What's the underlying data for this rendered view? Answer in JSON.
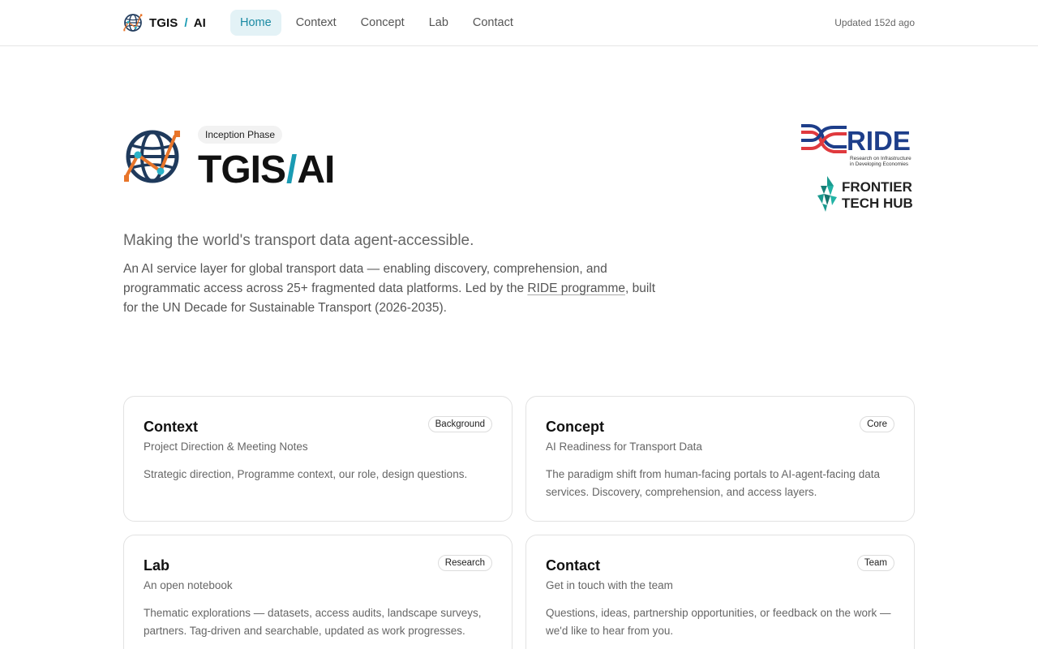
{
  "header": {
    "brand_left": "TGIS",
    "brand_sep": "/",
    "brand_right": "AI",
    "updated": "Updated 152d ago",
    "nav": [
      {
        "label": "Home",
        "active": true
      },
      {
        "label": "Context",
        "active": false
      },
      {
        "label": "Concept",
        "active": false
      },
      {
        "label": "Lab",
        "active": false
      },
      {
        "label": "Contact",
        "active": false
      }
    ]
  },
  "hero": {
    "badge": "Inception Phase",
    "title_left": "TGIS",
    "title_sep": "/",
    "title_right": "AI",
    "tagline": "Making the world's transport data agent-accessible.",
    "lead_before": "An AI service layer for global transport data — enabling discovery, comprehension, and programmatic access across 25+ fragmented data platforms. Led by the ",
    "lead_link": "RIDE programme",
    "lead_after": ", built for the UN Decade for Sustainable Transport (2026-2035).",
    "partners": {
      "ride_name": "RIDE",
      "ride_sub1": "Research on Infrastructure",
      "ride_sub2": "in Developing Economies",
      "fth_line1": "FRONTIER",
      "fth_line2": "TECH HUB"
    }
  },
  "cards": [
    {
      "title": "Context",
      "tag": "Background",
      "subtitle": "Project Direction & Meeting Notes",
      "description": "Strategic direction, Programme context, our role, design questions."
    },
    {
      "title": "Concept",
      "tag": "Core",
      "subtitle": "AI Readiness for Transport Data",
      "description": "The paradigm shift from human-facing portals to AI-agent-facing data services. Discovery, comprehension, and access layers."
    },
    {
      "title": "Lab",
      "tag": "Research",
      "subtitle": "An open notebook",
      "description": "Thematic explorations — datasets, access audits, landscape surveys, partners. Tag-driven and searchable, updated as work progresses."
    },
    {
      "title": "Contact",
      "tag": "Team",
      "subtitle": "Get in touch with the team",
      "description": "Questions, ideas, partnership opportunities, or feedback on the work — we'd like to hear from you."
    }
  ],
  "colors": {
    "accent": "#1a9bb3",
    "logo_navy": "#1f3a5c",
    "logo_orange": "#e8752a",
    "ride_red": "#e03a3e",
    "ride_blue": "#1d3e8a",
    "fth_teal": "#1a9a8f"
  }
}
